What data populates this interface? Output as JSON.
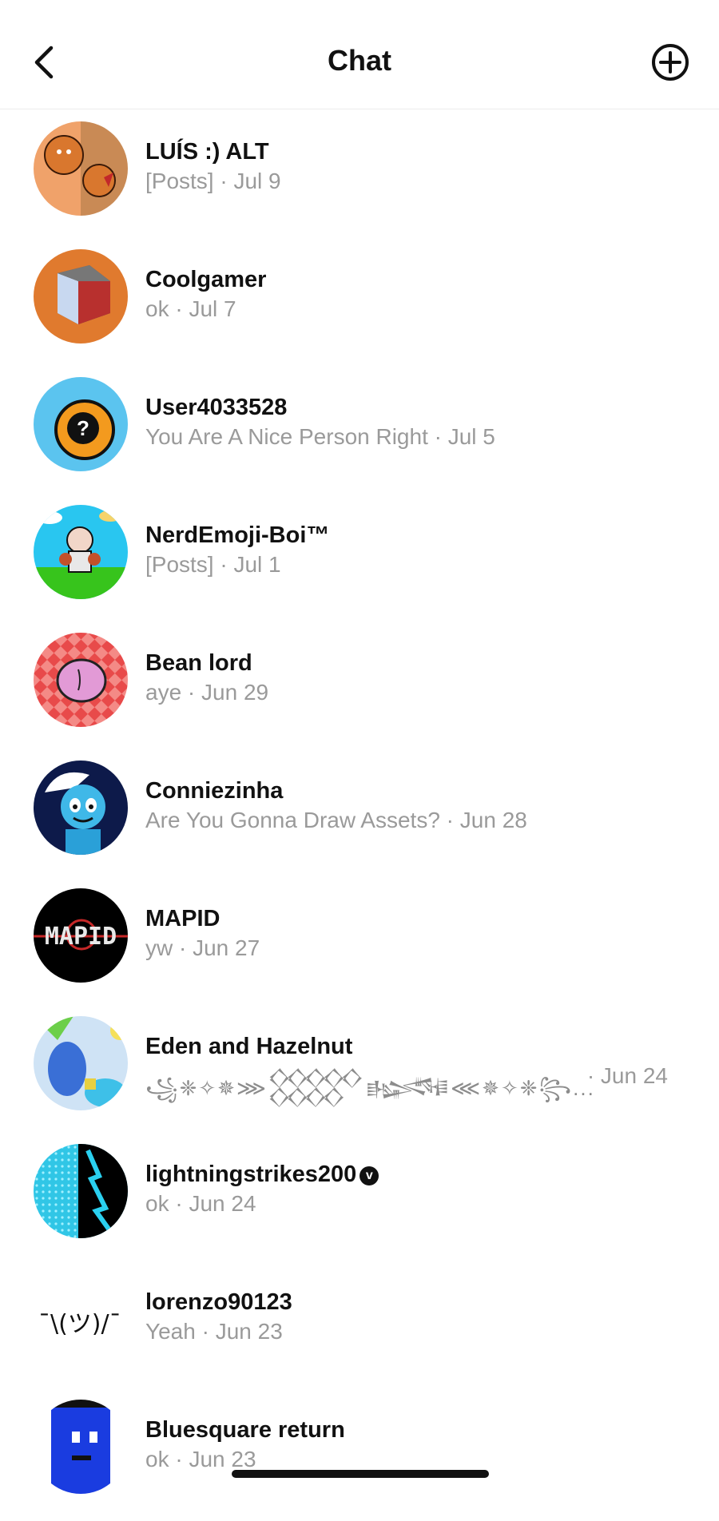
{
  "header": {
    "title": "Chat",
    "back_icon": "chevron-left-icon",
    "new_icon": "plus-circle-icon"
  },
  "chats": [
    {
      "name": "LUÍS :) ALT",
      "preview": "[Posts] · Jul 9"
    },
    {
      "name": "Coolgamer",
      "preview": "ok · Jul 7"
    },
    {
      "name": "User4033528",
      "preview": "You Are A Nice Person Right · Jul 5"
    },
    {
      "name": "NerdEmoji-Boi™",
      "preview": "[Posts] · Jul 1"
    },
    {
      "name": "Bean lord",
      "preview": "aye · Jun 29"
    },
    {
      "name": "Conniezinha",
      "preview": "Are You Gonna Draw Assets? · Jun 28"
    },
    {
      "name": "MAPID",
      "preview": "yw · Jun 27"
    },
    {
      "name": "Eden and Hazelnut",
      "preview": "꧁❈✧✵⋙𒐫𒈙⋘✵✧❈꧂...",
      "date": "· Jun 24"
    },
    {
      "name": "lightningstrikes200",
      "preview": "ok · Jun 24",
      "badge": "v"
    },
    {
      "name": "lorenzo90123",
      "preview": "Yeah · Jun 23",
      "avatar_text": "¯\\(ツ)/¯"
    },
    {
      "name": "Bluesquare return",
      "preview": "ok · Jun 23"
    }
  ]
}
